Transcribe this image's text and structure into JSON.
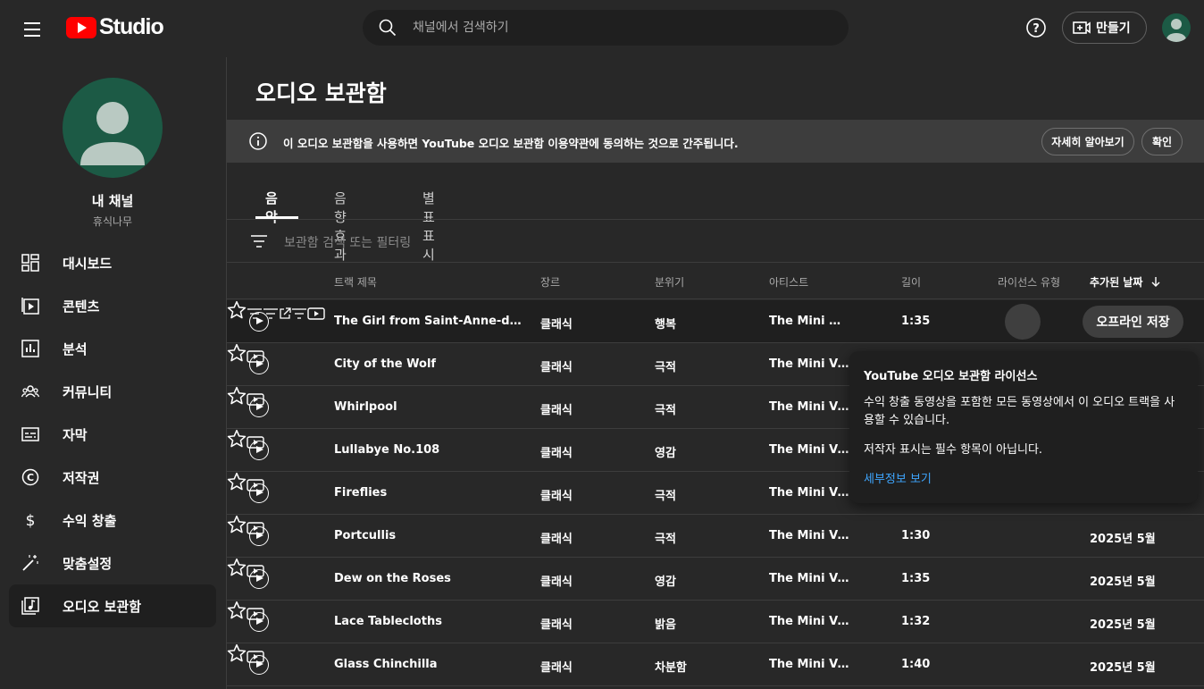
{
  "header": {
    "logo_text": "Studio",
    "search_placeholder": "채널에서 검색하기",
    "create_label": "만들기"
  },
  "sidebar": {
    "channel_name": "내 채널",
    "channel_handle": "휴식나무",
    "items": [
      {
        "label": "대시보드",
        "icon": "dashboard-icon"
      },
      {
        "label": "콘텐츠",
        "icon": "content-icon"
      },
      {
        "label": "분석",
        "icon": "analytics-icon"
      },
      {
        "label": "커뮤니티",
        "icon": "community-icon"
      },
      {
        "label": "자막",
        "icon": "subtitles-icon"
      },
      {
        "label": "저작권",
        "icon": "copyright-icon"
      },
      {
        "label": "수익 창출",
        "icon": "dollar-icon"
      },
      {
        "label": "맞춤설정",
        "icon": "magic-wand-icon"
      },
      {
        "label": "오디오 보관함",
        "icon": "audio-library-icon",
        "active": true
      }
    ]
  },
  "main": {
    "title": "오디오 보관함",
    "banner": {
      "text": "이 오디오 보관함을 사용하면 YouTube 오디오 보관함 이용약관에 동의하는 것으로 간주됩니다.",
      "learn_more": "자세히 알아보기",
      "confirm": "확인"
    },
    "tabs": [
      {
        "label": "음악",
        "active": true
      },
      {
        "label": "음향 효과"
      },
      {
        "label": "별표표시"
      }
    ],
    "filter_placeholder": "보관함 검색 또는 필터링",
    "columns": {
      "title": "트랙 제목",
      "genre": "장르",
      "mood": "분위기",
      "artist": "아티스트",
      "length": "길이",
      "license": "라이선스 유형",
      "date_added": "추가된 날짜"
    },
    "rows": [
      {
        "title": "The Girl from Saint-Anne-des-Plain…",
        "genre": "클래식",
        "mood": "행복",
        "artist": "The Mini …",
        "length": "1:35",
        "date": "",
        "action": "오프라인 저장"
      },
      {
        "title": "City of the Wolf",
        "genre": "클래식",
        "mood": "극적",
        "artist": "The Mini Vand…",
        "length": "",
        "date": ""
      },
      {
        "title": "Whirlpool",
        "genre": "클래식",
        "mood": "극적",
        "artist": "The Mini Vand…",
        "length": "",
        "date": ""
      },
      {
        "title": "Lullabye No.108",
        "genre": "클래식",
        "mood": "영감",
        "artist": "The Mini Vand…",
        "length": "",
        "date": ""
      },
      {
        "title": "Fireflies",
        "genre": "클래식",
        "mood": "극적",
        "artist": "The Mini Vand…",
        "length": "",
        "date": ""
      },
      {
        "title": "Portcullis",
        "genre": "클래식",
        "mood": "극적",
        "artist": "The Mini Vand…",
        "length": "1:30",
        "date": "2025년 5월"
      },
      {
        "title": "Dew on the Roses",
        "genre": "클래식",
        "mood": "영감",
        "artist": "The Mini Vand…",
        "length": "1:35",
        "date": "2025년 5월"
      },
      {
        "title": "Lace Tablecloths",
        "genre": "클래식",
        "mood": "밝음",
        "artist": "The Mini Vand…",
        "length": "1:32",
        "date": "2025년 5월"
      },
      {
        "title": "Glass Chinchilla",
        "genre": "클래식",
        "mood": "차분함",
        "artist": "The Mini Vand…",
        "length": "1:40",
        "date": "2025년 5월"
      }
    ],
    "tooltip": {
      "title": "YouTube 오디오 보관함 라이선스",
      "body1": "수익 창출 동영상을 포함한 모든 동영상에서 이 오디오 트랙을 사용할 수 있습니다.",
      "body2": "저작자 표시는 필수 항목이 아닙니다.",
      "link": "세부정보 보기"
    }
  }
}
